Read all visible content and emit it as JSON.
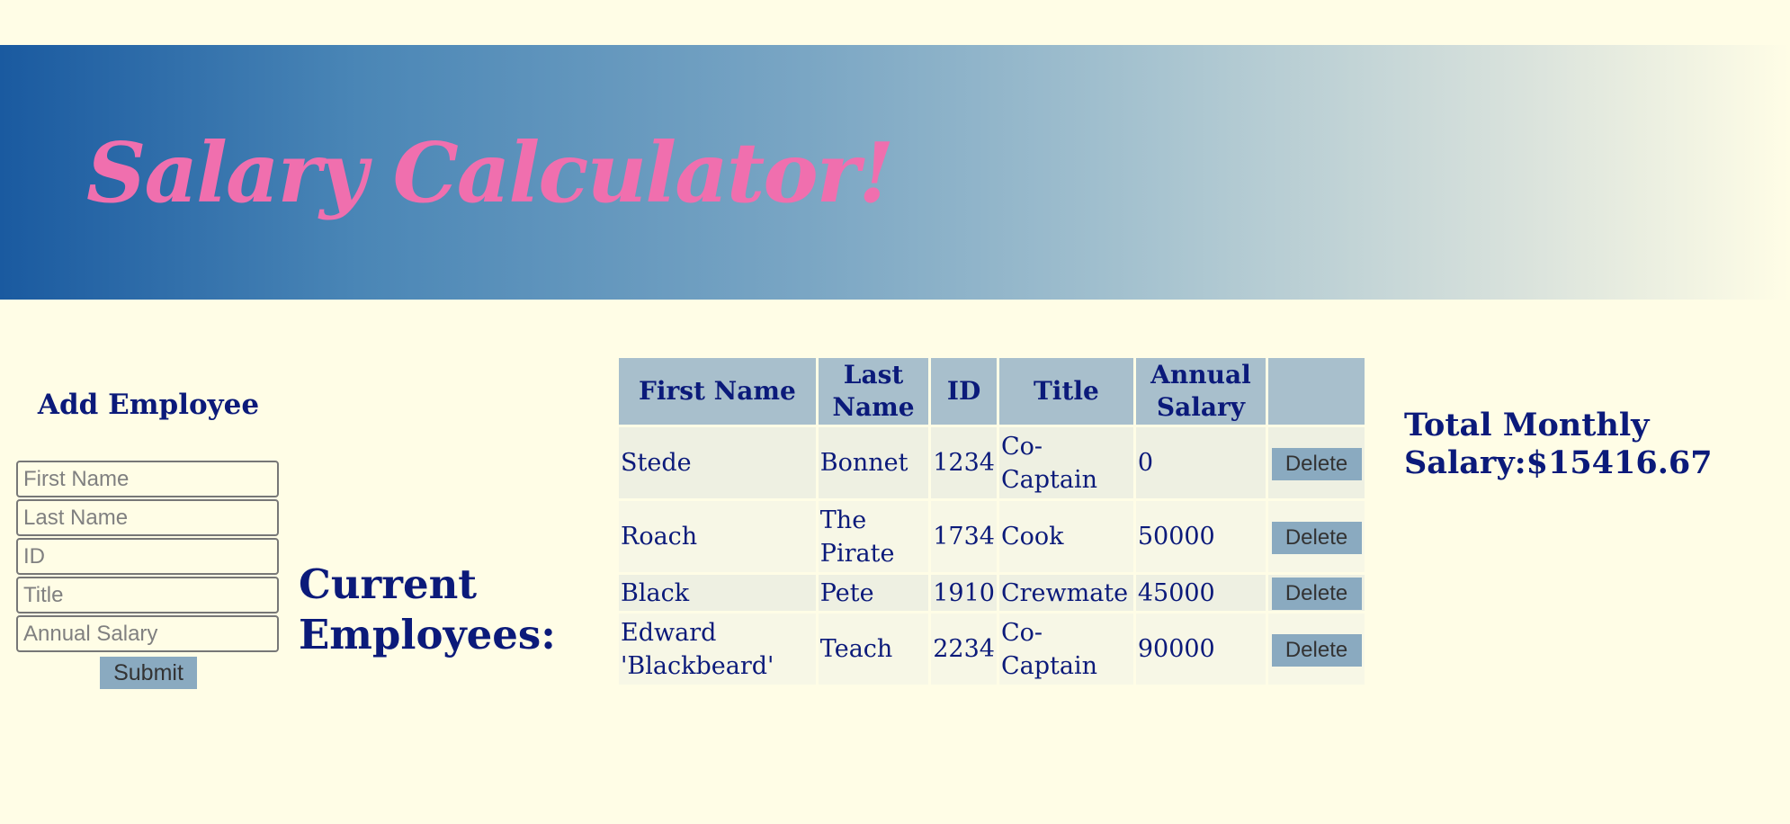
{
  "header": {
    "title": "Salary Calculator!"
  },
  "form": {
    "heading": "Add Employee",
    "first_name_placeholder": "First Name",
    "last_name_placeholder": "Last Name",
    "id_placeholder": "ID",
    "title_placeholder": "Title",
    "salary_placeholder": "Annual Salary",
    "submit_label": "Submit"
  },
  "employees": {
    "heading": "Current Employees:",
    "columns": [
      "First Name",
      "Last Name",
      "ID",
      "Title",
      "Annual Salary",
      ""
    ],
    "rows": [
      {
        "first": "Stede",
        "last": "Bonnet",
        "id": "1234",
        "title": "Co-Captain",
        "salary": "0",
        "action": "Delete"
      },
      {
        "first": "Roach",
        "last": "The Pirate",
        "id": "1734",
        "title": "Cook",
        "salary": "50000",
        "action": "Delete"
      },
      {
        "first": "Black",
        "last": "Pete",
        "id": "1910",
        "title": "Crewmate",
        "salary": "45000",
        "action": "Delete"
      },
      {
        "first": "Edward 'Blackbeard'",
        "last": "Teach",
        "id": "2234",
        "title": "Co-Captain",
        "salary": "90000",
        "action": "Delete"
      }
    ]
  },
  "summary": {
    "total_label": "Total Monthly Salary:$15416.67"
  },
  "colors": {
    "background": "#fffde6",
    "title_pink": "#f06fae",
    "text_navy": "#0b1a7a",
    "button_blue": "#8aaac0",
    "header_cell": "#a8bfcc"
  }
}
